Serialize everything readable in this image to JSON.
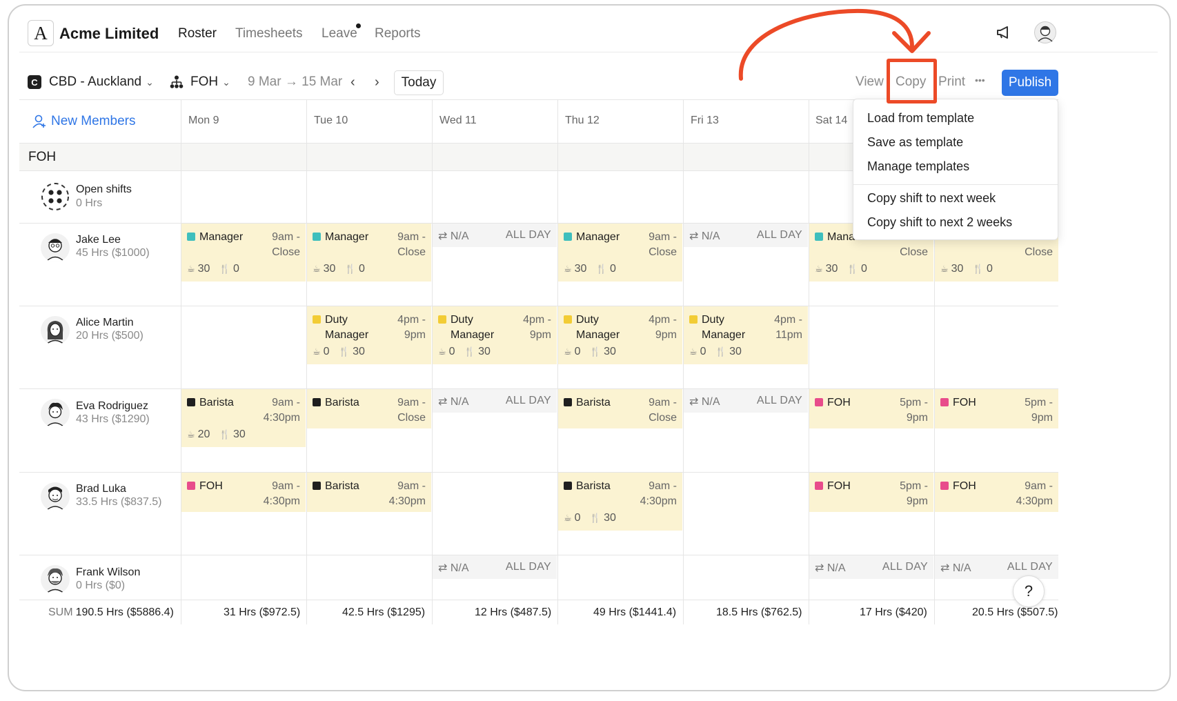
{
  "app": {
    "logo_letter": "A",
    "company": "Acme Limited",
    "nav": [
      "Roster",
      "Timesheets",
      "Leave",
      "Reports"
    ]
  },
  "toolbar": {
    "location_badge": "C",
    "location": "CBD - Auckland",
    "department": "FOH",
    "date_range": "9 Mar → 15 Mar",
    "prev": "‹",
    "next": "›",
    "today": "Today",
    "view": "View",
    "copy": "Copy",
    "print": "Print",
    "more": "•••",
    "publish": "Publish"
  },
  "copy_menu": {
    "items_top": [
      "Load from template",
      "Save as template",
      "Manage templates"
    ],
    "items_bottom": [
      "Copy shift to next week",
      "Copy shift to next 2 weeks"
    ]
  },
  "grid": {
    "new_members": "New Members",
    "days": [
      "Mon 9",
      "Tue 10",
      "Wed 11",
      "Thu 12",
      "Fri 13",
      "Sat 14"
    ],
    "group": "FOH",
    "open_shifts": {
      "name": "Open shifts",
      "hours": "0 Hrs"
    },
    "people": [
      {
        "name": "Jake Lee",
        "hours": "45 Hrs ($1000)"
      },
      {
        "name": "Alice Martin",
        "hours": "20 Hrs ($500)"
      },
      {
        "name": "Eva Rodriguez",
        "hours": "43 Hrs ($1290)"
      },
      {
        "name": "Brad Luka",
        "hours": "33.5 Hrs ($837.5)"
      },
      {
        "name": "Frank Wilson",
        "hours": "0 Hrs ($0)"
      }
    ],
    "role_colors": {
      "Manager": "#3fbfbd",
      "Duty": "#f2cc35",
      "Barista": "#1f1f1f",
      "FOH": "#e84c8b"
    },
    "na_label": "N/A",
    "all_day_label": "ALL DAY",
    "shifts": {
      "jake": [
        {
          "role": "Manager",
          "time1": "9am -",
          "time2": "Close",
          "b1": "30",
          "b2": "0"
        },
        {
          "role": "Manager",
          "time1": "9am -",
          "time2": "Close",
          "b1": "30",
          "b2": "0"
        },
        {
          "role": "Manager",
          "time1": "9am -",
          "time2": "Close",
          "b1": "30",
          "b2": "0"
        },
        {
          "role": "Mana",
          "time2": "Close",
          "b1": "30",
          "b2": "0"
        },
        {
          "time2": "Close",
          "b1": "30",
          "b2": "0"
        }
      ],
      "alice": [
        {
          "role1": "Duty",
          "role2": "Manager",
          "time1": "4pm -",
          "time2": "9pm",
          "b1": "0",
          "b2": "30"
        },
        {
          "role1": "Duty",
          "role2": "Manager",
          "time1": "4pm -",
          "time2": "9pm",
          "b1": "0",
          "b2": "30"
        },
        {
          "role1": "Duty",
          "role2": "Manager",
          "time1": "4pm -",
          "time2": "9pm",
          "b1": "0",
          "b2": "30"
        },
        {
          "role1": "Duty",
          "role2": "Manager",
          "time1": "4pm -",
          "time2": "11pm",
          "b1": "0",
          "b2": "30"
        }
      ],
      "eva": [
        {
          "role": "Barista",
          "time1": "9am -",
          "time2": "4:30pm",
          "b1": "20",
          "b2": "30"
        },
        {
          "role": "Barista",
          "time1": "9am -",
          "time2": "Close"
        },
        {
          "role": "Barista",
          "time1": "9am -",
          "time2": "Close"
        },
        {
          "role": "FOH",
          "time1": "5pm -",
          "time2": "9pm"
        },
        {
          "role": "FOH",
          "time1": "5pm -",
          "time2": "9pm"
        }
      ],
      "brad": [
        {
          "role": "FOH",
          "time1": "9am -",
          "time2": "4:30pm"
        },
        {
          "role": "Barista",
          "time1": "9am -",
          "time2": "4:30pm"
        },
        {
          "role": "Barista",
          "time1": "9am -",
          "time2": "4:30pm",
          "b1": "0",
          "b2": "30"
        },
        {
          "role": "FOH",
          "time1": "5pm -",
          "time2": "9pm"
        },
        {
          "role": "FOH",
          "time1": "9am -",
          "time2": "4:30pm"
        }
      ]
    },
    "sums": {
      "label": "SUM",
      "total": "190.5 Hrs ($5886.4)",
      "days": [
        "31 Hrs ($972.5)",
        "42.5 Hrs ($1295)",
        "12 Hrs ($487.5)",
        "49 Hrs ($1441.4)",
        "18.5 Hrs ($762.5)",
        "17 Hrs ($420)",
        "20.5 Hrs ($507.5)"
      ]
    }
  },
  "help": "?",
  "annotation_color": "#ec4a27"
}
